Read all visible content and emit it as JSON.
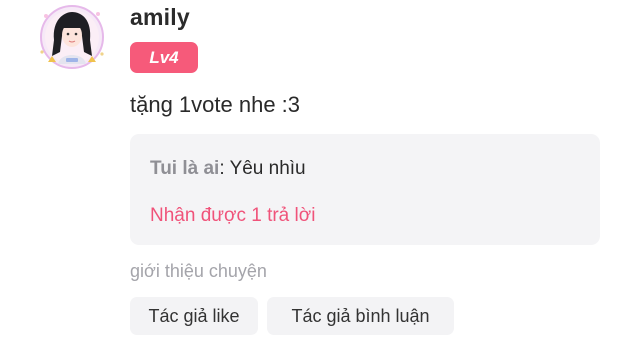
{
  "comment": {
    "username": "amily",
    "level_badge": "Lv4",
    "text": "tặng 1vote nhe :3",
    "reply": {
      "author": "Tui là ai",
      "separator": ": ",
      "text": "Yêu nhìu",
      "count_text": "Nhận được 1 trả lời"
    }
  },
  "intro": {
    "label": "giới thiệu chuyện",
    "tags": [
      "Tác giả like",
      "Tác giả bình luận"
    ]
  },
  "colors": {
    "accent": "#f65a7a",
    "reply_count": "#f0537a",
    "reply_bg": "#f4f4f6",
    "muted": "#a4a4aa"
  },
  "icons": {
    "avatar": "avatar-illustration",
    "bottom": [
      "partial-icon",
      "partial-icon"
    ]
  }
}
